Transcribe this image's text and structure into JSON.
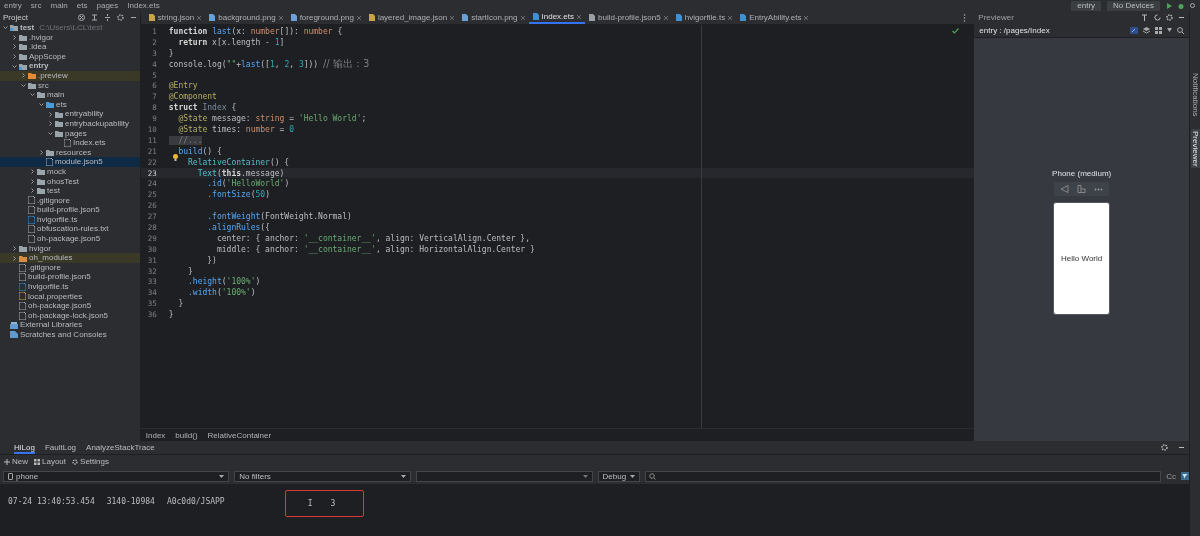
{
  "breadcrumb": [
    "entry",
    "src",
    "main",
    "ets",
    "pages",
    "Index.ets"
  ],
  "toolbar": {
    "run_config": "entry",
    "device": "No Devices"
  },
  "project": {
    "title": "Project",
    "tree": [
      {
        "label": "test",
        "path": "C:\\Users\\LCL\\test",
        "kind": "module",
        "expanded": true,
        "selected": false,
        "excluded": false,
        "children": [
          {
            "label": ".hvigor",
            "kind": "folder",
            "expanded": false,
            "selected": false,
            "excluded": false
          },
          {
            "label": ".idea",
            "kind": "folder",
            "expanded": false,
            "selected": false,
            "excluded": false
          },
          {
            "label": "AppScope",
            "kind": "folder",
            "expanded": false,
            "selected": false,
            "excluded": false
          },
          {
            "label": "entry",
            "kind": "module",
            "expanded": true,
            "selected": false,
            "excluded": false,
            "children": [
              {
                "label": ".preview",
                "kind": "folder",
                "expanded": false,
                "selected": false,
                "excluded": true
              },
              {
                "label": "src",
                "kind": "folder",
                "expanded": true,
                "selected": false,
                "excluded": false,
                "children": [
                  {
                    "label": "main",
                    "kind": "folder",
                    "expanded": true,
                    "selected": false,
                    "excluded": false,
                    "children": [
                      {
                        "label": "ets",
                        "kind": "source",
                        "expanded": true,
                        "selected": false,
                        "excluded": false,
                        "children": [
                          {
                            "label": "entryability",
                            "kind": "folder",
                            "expanded": false,
                            "selected": false,
                            "excluded": false
                          },
                          {
                            "label": "entrybackupability",
                            "kind": "folder",
                            "expanded": false,
                            "selected": false,
                            "excluded": false
                          },
                          {
                            "label": "pages",
                            "kind": "folder",
                            "expanded": true,
                            "selected": false,
                            "excluded": false,
                            "children": [
                              {
                                "label": "Index.ets",
                                "kind": "file",
                                "selected": false,
                                "excluded": false
                              }
                            ]
                          }
                        ]
                      },
                      {
                        "label": "resources",
                        "kind": "folder",
                        "expanded": false,
                        "selected": false,
                        "excluded": false
                      },
                      {
                        "label": "module.json5",
                        "kind": "file",
                        "selected": true,
                        "excluded": false
                      }
                    ]
                  },
                  {
                    "label": "mock",
                    "kind": "folder",
                    "expanded": false,
                    "selected": false,
                    "excluded": false
                  },
                  {
                    "label": "ohosTest",
                    "kind": "folder",
                    "expanded": false,
                    "selected": false,
                    "excluded": false
                  },
                  {
                    "label": "test",
                    "kind": "folder",
                    "expanded": false,
                    "selected": false,
                    "excluded": false
                  }
                ]
              },
              {
                "label": ".gitignore",
                "kind": "file",
                "selected": false,
                "excluded": false
              },
              {
                "label": "build-profile.json5",
                "kind": "file",
                "selected": false,
                "excluded": false
              },
              {
                "label": "hvigorfile.ts",
                "kind": "script",
                "selected": false,
                "excluded": false
              },
              {
                "label": "obfuscation-rules.txt",
                "kind": "file",
                "selected": false,
                "excluded": false
              },
              {
                "label": "oh-package.json5",
                "kind": "file",
                "selected": false,
                "excluded": false
              }
            ]
          },
          {
            "label": "hvigor",
            "kind": "folder",
            "expanded": false,
            "selected": false,
            "excluded": false
          },
          {
            "label": "oh_modules",
            "kind": "folder",
            "expanded": false,
            "selected": false,
            "excluded": true
          },
          {
            "label": ".gitignore",
            "kind": "file",
            "selected": false,
            "excluded": false
          },
          {
            "label": "build-profile.json5",
            "kind": "file",
            "selected": false,
            "excluded": false
          },
          {
            "label": "hvigorfile.ts",
            "kind": "script",
            "selected": false,
            "excluded": false
          },
          {
            "label": "local.properties",
            "kind": "properties",
            "selected": false,
            "excluded": false
          },
          {
            "label": "oh-package.json5",
            "kind": "file",
            "selected": false,
            "excluded": false
          },
          {
            "label": "oh-package-lock.json5",
            "kind": "file",
            "selected": false,
            "excluded": false
          }
        ]
      },
      {
        "label": "External Libraries",
        "kind": "library",
        "selected": false,
        "excluded": false
      },
      {
        "label": "Scratches and Consoles",
        "kind": "scratches",
        "selected": false,
        "excluded": false
      }
    ]
  },
  "editor_tabs": [
    {
      "label": "string.json",
      "kind": "json",
      "selected": false
    },
    {
      "label": "background.png",
      "kind": "png",
      "selected": false
    },
    {
      "label": "foreground.png",
      "kind": "png",
      "selected": false
    },
    {
      "label": "layered_image.json",
      "kind": "json",
      "selected": false
    },
    {
      "label": "startIcon.png",
      "kind": "png",
      "selected": false
    },
    {
      "label": "Index.ets",
      "kind": "ets",
      "selected": true
    },
    {
      "label": "build-profile.json5",
      "kind": "json5",
      "selected": false
    },
    {
      "label": "hvigorfile.ts",
      "kind": "ts",
      "selected": false
    },
    {
      "label": "EntryAbility.ets",
      "kind": "ets",
      "selected": false
    }
  ],
  "editor": {
    "lines": [
      {
        "number": "1",
        "current": false,
        "hint": false,
        "tokens": [
          {
            "text": "function ",
            "kind": "kw"
          },
          {
            "text": "last",
            "kind": "fn"
          },
          {
            "text": "(x: ",
            "kind": "plain"
          },
          {
            "text": "number",
            "kind": "type"
          },
          {
            "text": "[]): ",
            "kind": "plain"
          },
          {
            "text": "number",
            "kind": "type"
          },
          {
            "text": " {",
            "kind": "plain"
          }
        ]
      },
      {
        "number": "2",
        "current": false,
        "hint": false,
        "tokens": [
          {
            "text": "  return",
            "kind": "kw"
          },
          {
            "text": " x[x.length - ",
            "kind": "plain"
          },
          {
            "text": "1",
            "kind": "num"
          },
          {
            "text": "]",
            "kind": "plain"
          }
        ]
      },
      {
        "number": "3",
        "current": false,
        "hint": false,
        "tokens": [
          {
            "text": "}",
            "kind": "plain"
          }
        ]
      },
      {
        "number": "4",
        "current": false,
        "hint": false,
        "tokens": [
          {
            "text": "console.log(",
            "kind": "plain"
          },
          {
            "text": "\"\"",
            "kind": "str"
          },
          {
            "text": "+",
            "kind": "plain"
          },
          {
            "text": "last",
            "kind": "fn"
          },
          {
            "text": "([",
            "kind": "plain"
          },
          {
            "text": "1",
            "kind": "num"
          },
          {
            "text": ", ",
            "kind": "plain"
          },
          {
            "text": "2",
            "kind": "num"
          },
          {
            "text": ", ",
            "kind": "plain"
          },
          {
            "text": "3",
            "kind": "num"
          },
          {
            "text": "])) ",
            "kind": "plain"
          },
          {
            "text": "// 输出：3",
            "kind": "comment"
          }
        ]
      },
      {
        "number": "5",
        "current": false,
        "hint": false
      },
      {
        "number": "6",
        "current": false,
        "hint": false,
        "tokens": [
          {
            "text": "@Entry",
            "kind": "dec"
          }
        ]
      },
      {
        "number": "7",
        "current": false,
        "hint": false,
        "tokens": [
          {
            "text": "@Component",
            "kind": "dec"
          }
        ]
      },
      {
        "number": "8",
        "current": false,
        "hint": false,
        "tokens": [
          {
            "text": "struct ",
            "kind": "kw"
          },
          {
            "text": "Index",
            "kind": "name"
          },
          {
            "text": " {",
            "kind": "plain"
          }
        ]
      },
      {
        "number": "9",
        "current": false,
        "hint": false,
        "tokens": [
          {
            "text": "  @State",
            "kind": "dec"
          },
          {
            "text": " message: ",
            "kind": "plain"
          },
          {
            "text": "string",
            "kind": "type"
          },
          {
            "text": " = ",
            "kind": "plain"
          },
          {
            "text": "'Hello World'",
            "kind": "str"
          },
          {
            "text": ";",
            "kind": "plain"
          }
        ]
      },
      {
        "number": "10",
        "current": false,
        "hint": false,
        "tokens": [
          {
            "text": "  @State",
            "kind": "dec"
          },
          {
            "text": " times: ",
            "kind": "plain"
          },
          {
            "text": "number",
            "kind": "type"
          },
          {
            "text": " = ",
            "kind": "plain"
          },
          {
            "text": "0",
            "kind": "num"
          }
        ]
      },
      {
        "number": "11",
        "current": false,
        "hint": false,
        "tokens": [
          {
            "text": "  //...",
            "kind": "fold"
          }
        ]
      },
      {
        "number": "21",
        "current": false,
        "hint": false,
        "tokens": [
          {
            "text": "  build",
            "kind": "fn"
          },
          {
            "text": "() {",
            "kind": "plain"
          }
        ]
      },
      {
        "number": "22",
        "current": false,
        "hint": true,
        "tokens": [
          {
            "text": "    RelativeContainer",
            "kind": "comp"
          },
          {
            "text": "() {",
            "kind": "plain"
          }
        ]
      },
      {
        "number": "23",
        "current": true,
        "hint": false,
        "tokens": [
          {
            "text": "      Text",
            "kind": "comp"
          },
          {
            "text": "(",
            "kind": "plain"
          },
          {
            "text": "this",
            "kind": "kw"
          },
          {
            "text": ".message)",
            "kind": "plain"
          }
        ]
      },
      {
        "number": "24",
        "current": false,
        "hint": false,
        "tokens": [
          {
            "text": "        .id",
            "kind": "fn"
          },
          {
            "text": "(",
            "kind": "plain"
          },
          {
            "text": "'HelloWorld'",
            "kind": "str"
          },
          {
            "text": ")",
            "kind": "plain"
          }
        ]
      },
      {
        "number": "25",
        "current": false,
        "hint": false,
        "tokens": [
          {
            "text": "        .fontSize",
            "kind": "fn"
          },
          {
            "text": "(",
            "kind": "plain"
          },
          {
            "text": "50",
            "kind": "num"
          },
          {
            "text": ")",
            "kind": "plain"
          }
        ]
      },
      {
        "number": "26",
        "current": false,
        "hint": false
      },
      {
        "number": "27",
        "current": false,
        "hint": false,
        "tokens": [
          {
            "text": "        .fontWeight",
            "kind": "fn"
          },
          {
            "text": "(FontWeight.Normal)",
            "kind": "plain"
          }
        ]
      },
      {
        "number": "28",
        "current": false,
        "hint": false,
        "tokens": [
          {
            "text": "        .alignRules",
            "kind": "fn"
          },
          {
            "text": "({",
            "kind": "plain"
          }
        ]
      },
      {
        "number": "29",
        "current": false,
        "hint": false,
        "tokens": [
          {
            "text": "          center: { anchor: ",
            "kind": "plain"
          },
          {
            "text": "'__container__'",
            "kind": "str"
          },
          {
            "text": ", align: VerticalAlign.Center },",
            "kind": "plain"
          }
        ]
      },
      {
        "number": "30",
        "current": false,
        "hint": false,
        "tokens": [
          {
            "text": "          middle: { anchor: ",
            "kind": "plain"
          },
          {
            "text": "'__container__'",
            "kind": "str"
          },
          {
            "text": ", align: HorizontalAlign.Center }",
            "kind": "plain"
          }
        ]
      },
      {
        "number": "31",
        "current": false,
        "hint": false,
        "tokens": [
          {
            "text": "        })",
            "kind": "plain"
          }
        ]
      },
      {
        "number": "32",
        "current": false,
        "hint": false,
        "tokens": [
          {
            "text": "    }",
            "kind": "plain"
          }
        ]
      },
      {
        "number": "33",
        "current": false,
        "hint": false,
        "tokens": [
          {
            "text": "    .height",
            "kind": "fn"
          },
          {
            "text": "(",
            "kind": "plain"
          },
          {
            "text": "'100%'",
            "kind": "str"
          },
          {
            "text": ")",
            "kind": "plain"
          }
        ]
      },
      {
        "number": "34",
        "current": false,
        "hint": false,
        "tokens": [
          {
            "text": "    .width",
            "kind": "fn"
          },
          {
            "text": "(",
            "kind": "plain"
          },
          {
            "text": "'100%'",
            "kind": "str"
          },
          {
            "text": ")",
            "kind": "plain"
          }
        ]
      },
      {
        "number": "35",
        "current": false,
        "hint": false,
        "tokens": [
          {
            "text": "  }",
            "kind": "plain"
          }
        ]
      },
      {
        "number": "36",
        "current": false,
        "hint": false,
        "tokens": [
          {
            "text": "}",
            "kind": "plain"
          }
        ]
      }
    ],
    "breadcrumb": [
      "Index",
      "build()",
      "RelativeContainer"
    ]
  },
  "previewer": {
    "title": "Previewer",
    "page": "entry : /pages/Index",
    "device": "Phone (medium)",
    "screen_text": "Hello World"
  },
  "side_tabs": [
    {
      "label": "Notifications",
      "selected": false
    },
    {
      "label": "Previewer",
      "selected": true
    }
  ],
  "log_panel": {
    "tabs": [
      {
        "label": "HiLog",
        "selected": true
      },
      {
        "label": "FaultLog",
        "selected": false
      },
      {
        "label": "AnalyzeStackTrace",
        "selected": false
      }
    ],
    "actions": [
      {
        "label": "New",
        "kind": "add"
      },
      {
        "label": "Layout",
        "kind": "layout"
      },
      {
        "label": "Settings",
        "kind": "settings"
      }
    ],
    "filters": {
      "device": "phone",
      "filter": "No filters",
      "level": "Debug",
      "case_toggle": "Cc"
    },
    "rows": [
      {
        "time": "07-24 13:40:53.454",
        "pid": "3140-10984",
        "tag": "A0c0d0/JSAPP",
        "level": "I",
        "message": "3",
        "highlighted": true
      }
    ]
  }
}
